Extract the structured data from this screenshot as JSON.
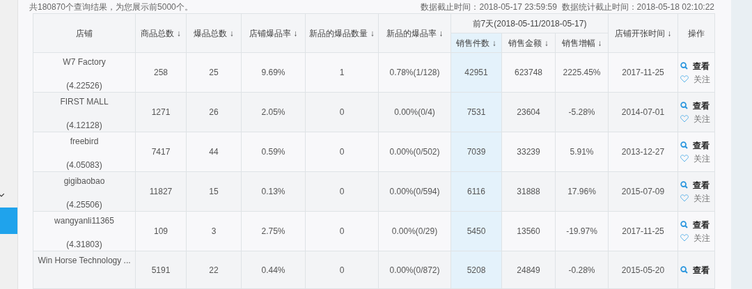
{
  "summary": "共180870个查询结果，为您展示前5000个。",
  "data_time": "数据截止时间：2018-05-17 23:59:59  数据统计截止时间：2018-05-18 02:10:22",
  "table": {
    "columns": [
      {
        "label": "店铺",
        "highlighted": false
      },
      {
        "label": "商品总数 ↓",
        "highlighted": false
      },
      {
        "label": "爆品总数 ↓",
        "highlighted": false
      },
      {
        "label": "店铺爆品率 ↓",
        "highlighted": false
      },
      {
        "label": "新品的爆品数量 ↓",
        "highlighted": false
      },
      {
        "label": "新品的爆品率 ↓",
        "highlighted": false
      },
      {
        "label": "前7天(2018-05-11/2018-05-17)",
        "colspan": 3,
        "children": [
          {
            "label": "销售件数 ↓",
            "highlighted": true
          },
          {
            "label": "销售金额 ↓",
            "highlighted": false
          },
          {
            "label": "销售增幅 ↓",
            "highlighted": false
          }
        ]
      },
      {
        "label": "店铺开张时间 ↓",
        "highlighted": false
      },
      {
        "label": "操作",
        "highlighted": false
      }
    ],
    "rows": [
      {
        "cells": [
          "W7 Factory",
          "258",
          "25",
          "9.69%",
          "1",
          "0.78%(1/128)",
          "42951",
          "623748",
          "2225.45%",
          "2017-11-25"
        ],
        "score": "(4.22526)",
        "actions": [
          "查看",
          "关注"
        ]
      },
      {
        "cells": [
          "FIRST MALL",
          "1271",
          "26",
          "2.05%",
          "0",
          "0.00%(0/4)",
          "7531",
          "23604",
          "-5.28%",
          "2014-07-01"
        ],
        "score": "(4.12128)",
        "actions": [
          "查看",
          "关注"
        ]
      },
      {
        "cells": [
          "freebird",
          "7417",
          "44",
          "0.59%",
          "0",
          "0.00%(0/502)",
          "7039",
          "33239",
          "5.91%",
          "2013-12-27"
        ],
        "score": "(4.05083)",
        "actions": [
          "查看",
          "关注"
        ]
      },
      {
        "cells": [
          "gigibaobao",
          "11827",
          "15",
          "0.13%",
          "0",
          "0.00%(0/594)",
          "6116",
          "31888",
          "17.96%",
          "2015-07-09"
        ],
        "score": "(4.25506)",
        "actions": [
          "查看",
          "关注"
        ]
      },
      {
        "cells": [
          "wangyanli11365",
          "109",
          "3",
          "2.75%",
          "0",
          "0.00%(0/29)",
          "5450",
          "13560",
          "-19.97%",
          "2017-11-25"
        ],
        "score": "(4.31803)",
        "actions": [
          "查看",
          "关注"
        ]
      },
      {
        "cells": [
          "Win Horse Technology ...",
          "5191",
          "22",
          "0.44%",
          "0",
          "0.00%(0/872)",
          "5208",
          "24849",
          "-0.28%",
          "2015-05-20"
        ],
        "actions": [
          "查看"
        ]
      }
    ]
  }
}
